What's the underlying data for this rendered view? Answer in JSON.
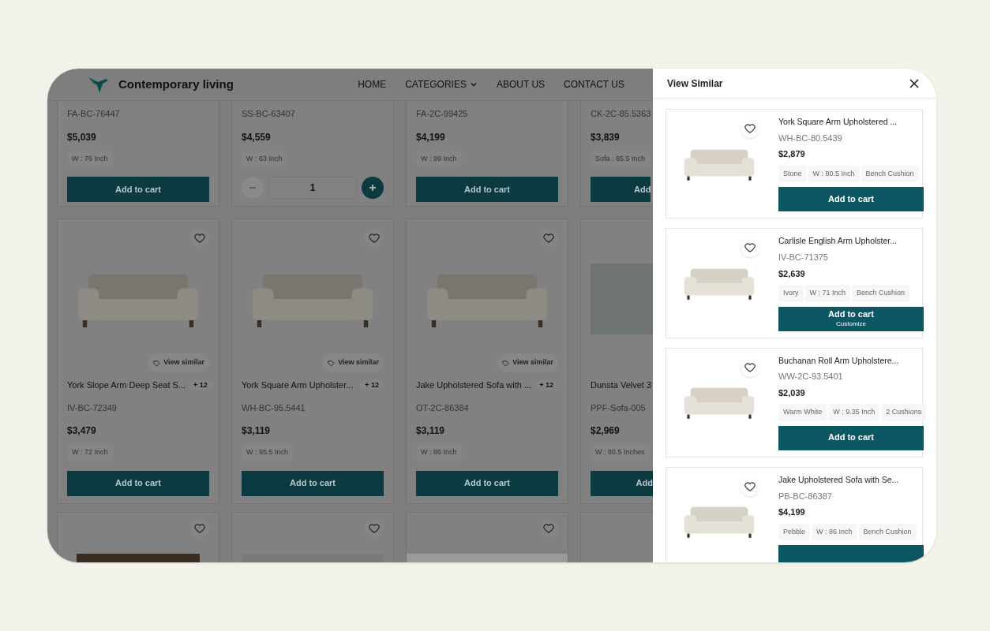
{
  "brand": {
    "name": "Contemporary living"
  },
  "nav": [
    {
      "label": "HOME",
      "dropdown": false
    },
    {
      "label": "CATEGORIES",
      "dropdown": true
    },
    {
      "label": "ABOUT US",
      "dropdown": false
    },
    {
      "label": "CONTACT US",
      "dropdown": false
    }
  ],
  "top_row": [
    {
      "code": "FA-BC-76447",
      "price": "$5,039",
      "tag": "W : 76 Inch",
      "action": {
        "kind": "button",
        "label": "Add to cart"
      }
    },
    {
      "code": "SS-BC-63407",
      "price": "$4,559",
      "tag": "W : 63 Inch",
      "action": {
        "kind": "stepper",
        "quantity": "1"
      }
    },
    {
      "code": "FA-2C-99425",
      "price": "$4,199",
      "tag": "W : 99 Inch",
      "action": {
        "kind": "button",
        "label": "Add to cart"
      }
    },
    {
      "code": "CK-2C-85.5363",
      "price": "$3,839",
      "tag": "Sofa : 85.5 Inch",
      "action": {
        "kind": "button",
        "label": "Add"
      }
    }
  ],
  "middle_row": [
    {
      "view_similar": "View similar",
      "name": "York Slope Arm Deep Seat S...",
      "more": "+ 12",
      "code": "IV-BC-72349",
      "price": "$3,479",
      "tag": "W : 72 Inch",
      "button": "Add to cart"
    },
    {
      "view_similar": "View similar",
      "name": "York Square Arm Upholster...",
      "more": "+ 12",
      "code": "WH-BC-95.5441",
      "price": "$3,119",
      "tag": "W : 95.5 Inch",
      "button": "Add to cart"
    },
    {
      "view_similar": "View similar",
      "name": "Jake Upholstered Sofa with ...",
      "more": "+ 12",
      "code": "OT-2C-86384",
      "price": "$3,119",
      "tag": "W : 86 Inch",
      "button": "Add to cart"
    },
    {
      "name": "Dunsta Velvet 3",
      "code": "PPF-Sofa-005",
      "price": "$2,969",
      "tag": "W : 80.5 Inches",
      "button": "Add"
    }
  ],
  "drawer": {
    "title": "View Similar",
    "items": [
      {
        "name": "York Square Arm Upholstered ...",
        "code": "WH-BC-80.5439",
        "price": "$2,879",
        "tags": [
          "Stone",
          "W : 80.5 Inch",
          "Bench Cushion"
        ],
        "button": "Add to cart"
      },
      {
        "name": "Carlisle English Arm Upholster...",
        "code": "IV-BC-71375",
        "price": "$2,639",
        "tags": [
          "Ivory",
          "W : 71 Inch",
          "Bench Cushion"
        ],
        "button": "Add to cart",
        "sublabel": "Customize"
      },
      {
        "name": "Buchanan Roll Arm Upholstere...",
        "code": "WW-2C-93.5401",
        "price": "$2,039",
        "tags": [
          "Warm White",
          "W : 9.35 Inch",
          "2 Cushions"
        ],
        "button": "Add to cart"
      },
      {
        "name": "Jake Upholstered Sofa with Se...",
        "code": "PB-BC-86387",
        "price": "$4,199",
        "tags": [
          "Pebble",
          "W : 86 Inch",
          "Bench Cushion"
        ]
      }
    ]
  }
}
